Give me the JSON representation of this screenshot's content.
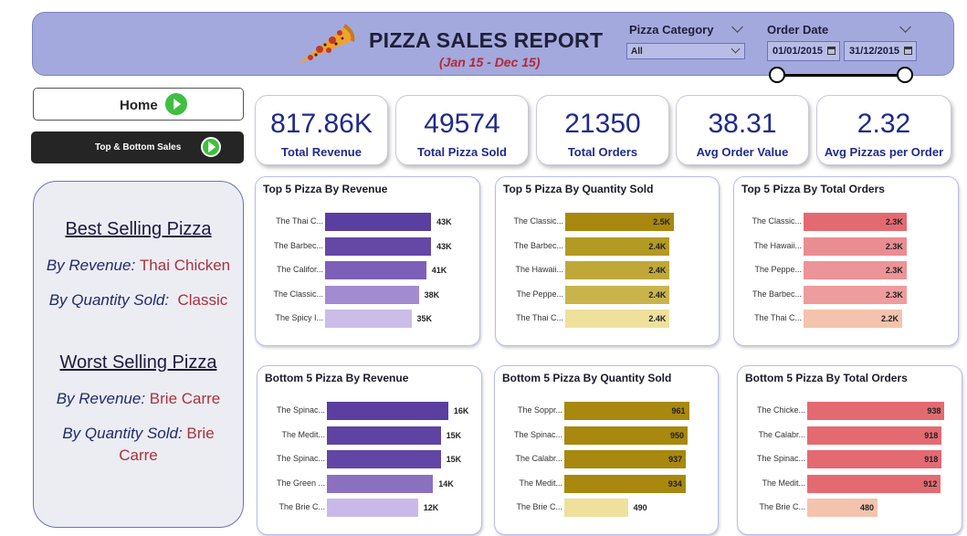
{
  "header": {
    "title": "PIZZA SALES REPORT",
    "subtitle": "(Jan 15 - Dec 15)",
    "category_label": "Pizza Category",
    "category_value": "All",
    "date_label": "Order Date",
    "date_start": "01/01/2015",
    "date_end": "31/12/2015"
  },
  "nav": {
    "home_label": "Home",
    "top_bottom_label": "Top & Bottom Sales"
  },
  "kpis": [
    {
      "value": "817.86K",
      "label": "Total Revenue"
    },
    {
      "value": "49574",
      "label": "Total Pizza Sold"
    },
    {
      "value": "21350",
      "label": "Total Orders"
    },
    {
      "value": "38.31",
      "label": "Avg Order Value"
    },
    {
      "value": "2.32",
      "label": "Avg Pizzas per Order"
    }
  ],
  "best_worst": {
    "best_title": "Best Selling Pizza",
    "best_rev_label": "By Revenue",
    "best_rev_value": "Thai Chicken",
    "best_qty_label": "By Quantity Sold:",
    "best_qty_value": "Classic",
    "worst_title": "Worst Selling Pizza",
    "worst_rev_label": "By Revenue",
    "worst_rev_value": "Brie Carre",
    "worst_qty_label": "By Quantity Sold:",
    "worst_qty_value1": "Brie",
    "worst_qty_value2": "Carre"
  },
  "chart_data": [
    {
      "type": "bar",
      "title": "Top 5 Pizza By Revenue",
      "categories": [
        "The Thai C...",
        "The Barbec...",
        "The Califor...",
        "The Classic...",
        "The Spicy I..."
      ],
      "values": [
        43,
        43,
        41,
        38,
        35
      ],
      "labels": [
        "43K",
        "43K",
        "41K",
        "38K",
        "35K"
      ],
      "xlim": [
        0,
        60
      ],
      "colors": [
        "#5a3ea0",
        "#6547a6",
        "#7c5fb6",
        "#a38bd2",
        "#cbbce8"
      ]
    },
    {
      "type": "bar",
      "title": "Top 5 Pizza By Quantity Sold",
      "categories": [
        "The Classic...",
        "The Barbec...",
        "The Hawaii...",
        "The Peppe...",
        "The Thai C..."
      ],
      "values": [
        2.5,
        2.4,
        2.4,
        2.4,
        2.4
      ],
      "labels": [
        "2.5K",
        "2.4K",
        "2.4K",
        "2.4K",
        "2.4K"
      ],
      "xlim": [
        0,
        3.4
      ],
      "colors": [
        "#a8880e",
        "#b39a22",
        "#bfa838",
        "#c9b44c",
        "#efe19c"
      ]
    },
    {
      "type": "bar",
      "title": "Top 5 Pizza By Total Orders",
      "categories": [
        "The Classic...",
        "The Hawaii...",
        "The Peppe...",
        "The Barbec...",
        "The Thai C..."
      ],
      "values": [
        2.3,
        2.3,
        2.3,
        2.3,
        2.2
      ],
      "labels": [
        "2.3K",
        "2.3K",
        "2.3K",
        "2.3K",
        "2.2K"
      ],
      "xlim": [
        0,
        3.3
      ],
      "colors": [
        "#e46a72",
        "#ea8d92",
        "#ec9497",
        "#ee9c9d",
        "#f4c3ae"
      ]
    },
    {
      "type": "bar",
      "title": "Bottom 5 Pizza By Revenue",
      "categories": [
        "The Spinac...",
        "The Medit...",
        "The Spinac...",
        "The Green ...",
        "The Brie C..."
      ],
      "values": [
        16,
        15,
        15,
        14,
        12
      ],
      "labels": [
        "16K",
        "15K",
        "15K",
        "14K",
        "12K"
      ],
      "xlim": [
        0,
        19.5
      ],
      "colors": [
        "#5a3ea0",
        "#5f43a3",
        "#6246a5",
        "#8b70c0",
        "#c9b9e8"
      ]
    },
    {
      "type": "bar",
      "title": "Bottom 5 Pizza By Quantity Sold",
      "categories": [
        "The Soppr...",
        "The Spinac...",
        "The Calabr...",
        "The Medit...",
        "The Brie C..."
      ],
      "values": [
        961,
        950,
        937,
        934,
        490
      ],
      "labels": [
        "961",
        "950",
        "937",
        "934",
        "490"
      ],
      "xlim": [
        0,
        1140
      ],
      "colors": [
        "#a8880e",
        "#a8880e",
        "#a8880e",
        "#a8880e",
        "#efe19c"
      ]
    },
    {
      "type": "bar",
      "title": "Bottom 5 Pizza By Total Orders",
      "categories": [
        "The Chicke...",
        "The Calabr...",
        "The Spinac...",
        "The Medit...",
        "The Brie C..."
      ],
      "values": [
        938,
        918,
        918,
        912,
        480
      ],
      "labels": [
        "938",
        "918",
        "918",
        "912",
        "480"
      ],
      "xlim": [
        0,
        1010
      ],
      "colors": [
        "#e46a72",
        "#e46a72",
        "#e46a72",
        "#e46a72",
        "#f4c3ae"
      ]
    }
  ]
}
